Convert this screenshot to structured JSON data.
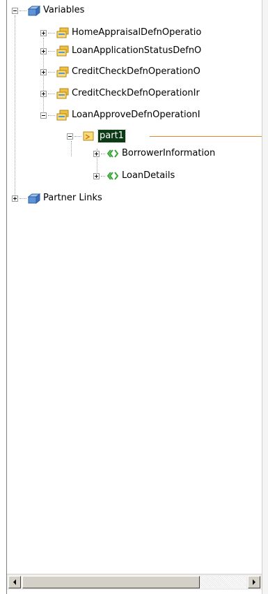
{
  "tree": {
    "variables_label": "Variables",
    "variables_children": [
      {
        "label": "HomeAppraisalDefnOperatio"
      },
      {
        "label": "LoanApplicationStatusDefnO"
      },
      {
        "label": "CreditCheckDefnOperationO"
      },
      {
        "label": "CreditCheckDefnOperationIr"
      },
      {
        "label": "LoanApproveDefnOperationI"
      }
    ],
    "part_label": "part1",
    "part_children": [
      {
        "label": "BorrowerInformation"
      },
      {
        "label": "LoanDetails"
      }
    ],
    "partner_links_label": "Partner Links"
  },
  "colors": {
    "selected_bg": "#0b3a14",
    "connector_line": "#e1882e",
    "variable_icon": "#f0c040",
    "type_icon": "#36a436"
  }
}
